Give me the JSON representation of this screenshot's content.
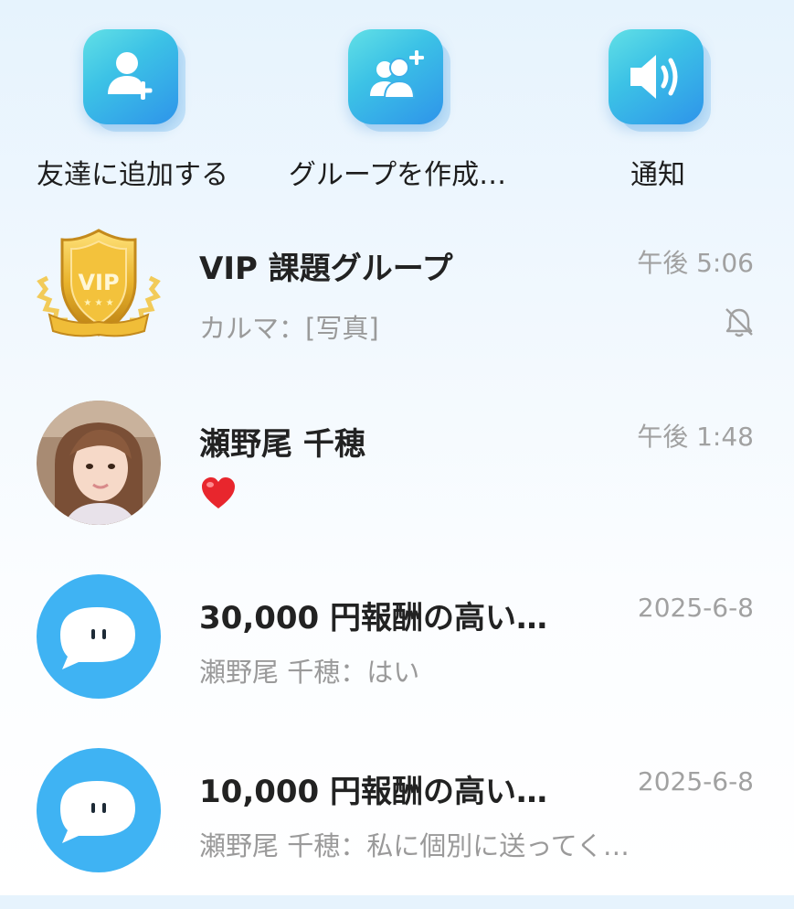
{
  "actions": [
    {
      "label": "友達に追加する",
      "icon": "add-friend-icon"
    },
    {
      "label": "グループを作成…",
      "icon": "create-group-icon"
    },
    {
      "label": "通知",
      "icon": "speaker-icon"
    }
  ],
  "chats": [
    {
      "name": "VIP 課題グループ",
      "preview": "カルマ：[写真]",
      "time": "午後 5:06",
      "muted": true,
      "avatar": "vip-shield-badge",
      "avatar_text": "VIP"
    },
    {
      "name": "瀬野尾 千穂",
      "preview": "❤️",
      "time": "午後 1:48",
      "muted": false,
      "avatar": "user-photo"
    },
    {
      "name": "30,000 円報酬の高い…",
      "preview": "瀬野尾 千穂：はい",
      "time": "2025-6-8",
      "muted": false,
      "avatar": "chat-bubble-avatar"
    },
    {
      "name": "10,000 円報酬の高い…",
      "preview": "瀬野尾 千穂：私に個別に送ってく…",
      "time": "2025-6-8",
      "muted": false,
      "avatar": "chat-bubble-avatar"
    }
  ],
  "colors": {
    "accent_blue": "#2e94ea",
    "accent_teal": "#62e0e6",
    "gold": "#e9b32c"
  }
}
